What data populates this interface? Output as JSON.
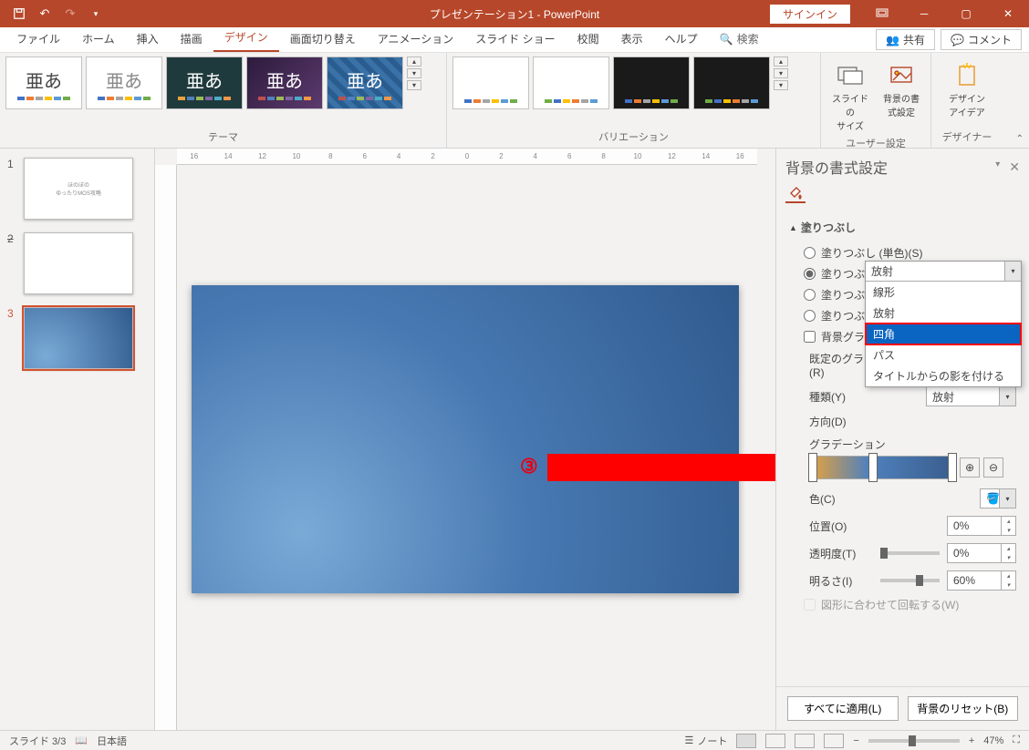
{
  "titlebar": {
    "title": "プレゼンテーション1 - PowerPoint",
    "signin": "サインイン"
  },
  "tabs": {
    "file": "ファイル",
    "home": "ホーム",
    "insert": "挿入",
    "draw": "描画",
    "design": "デザイン",
    "transition": "画面切り替え",
    "animation": "アニメーション",
    "slideshow": "スライド ショー",
    "review": "校閲",
    "view": "表示",
    "help": "ヘルプ",
    "search": "検索",
    "share": "共有",
    "comment": "コメント"
  },
  "ribbon": {
    "themes_label": "テーマ",
    "themes_sample": "亜あ",
    "variations_label": "バリエーション",
    "slide_size": "スライドの\nサイズ",
    "bg_format": "背景の書\n式設定",
    "user_group": "ユーザー設定",
    "design_ideas": "デザイン\nアイデア",
    "designer_label": "デザイナー"
  },
  "thumbs": {
    "n1": "1",
    "n2": "2",
    "n3": "3"
  },
  "pane": {
    "title": "背景の書式設定",
    "fill_section": "塗りつぶし",
    "r_solid": "塗りつぶし (単色)(S)",
    "r_grad": "塗りつぶし (グラデーション)(G)",
    "r_pic": "塗りつぶし (図またはテクスチャ)(P)",
    "r_pat": "塗りつぶし (パターン)(A)",
    "chk_hide": "背景グラフィックを表示しない(H)",
    "preset_grad": "既定のグラデーション(R)",
    "type": "種類(Y)",
    "type_val": "放射",
    "direction": "方向(D)",
    "grad_stops": "グラデーション",
    "color": "色(C)",
    "position": "位置(O)",
    "position_val": "0%",
    "transparency": "透明度(T)",
    "transparency_val": "0%",
    "brightness": "明るさ(I)",
    "brightness_val": "60%",
    "rotate_with_shape": "図形に合わせて回転する(W)",
    "apply_all": "すべてに適用(L)",
    "reset_bg": "背景のリセット(B)"
  },
  "dropdown": {
    "current": "放射",
    "opt_linear": "線形",
    "opt_radial": "放射",
    "opt_rect": "四角",
    "opt_path": "パス",
    "opt_title_shadow": "タイトルからの影を付ける"
  },
  "annotation": {
    "num3": "③"
  },
  "status": {
    "slide": "スライド 3/3",
    "lang": "日本語",
    "notes": "ノート",
    "zoom": "47%",
    "minus": "−",
    "plus": "+"
  },
  "ruler": {
    "t16n": "16",
    "t14n": "14",
    "t12n": "12",
    "t10n": "10",
    "t8n": "8",
    "t6n": "6",
    "t4n": "4",
    "t2n": "2",
    "t0": "0",
    "t2": "2",
    "t4": "4",
    "t6": "6",
    "t8": "8",
    "t10": "10",
    "t12": "12",
    "t14": "14",
    "t16": "16"
  }
}
